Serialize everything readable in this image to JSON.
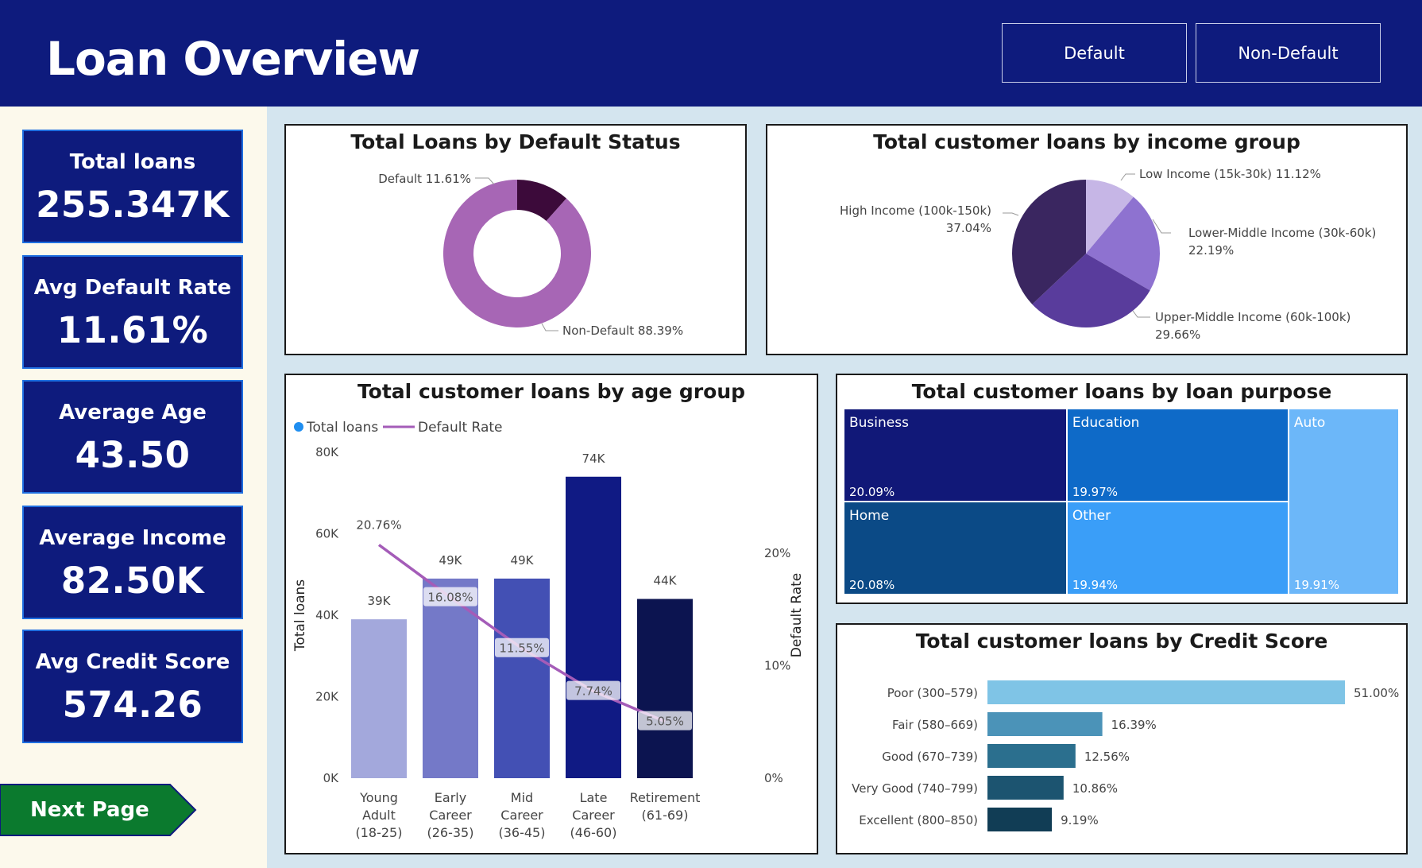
{
  "header": {
    "title": "Loan Overview",
    "buttons": [
      {
        "label": "Default"
      },
      {
        "label": "Non-Default"
      }
    ]
  },
  "kpis": [
    {
      "label": "Total loans",
      "value": "255.347K"
    },
    {
      "label": "Avg Default Rate",
      "value": "11.61%"
    },
    {
      "label": "Average Age",
      "value": "43.50"
    },
    {
      "label": "Average Income",
      "value": "82.50K"
    },
    {
      "label": "Avg Credit Score",
      "value": "574.26"
    }
  ],
  "nav": {
    "next_label": "Next Page"
  },
  "colors": {
    "header": "#0e1b7d",
    "kpi_border": "#1f6fe0",
    "next_button": "#0b7a2e"
  },
  "chart_data": [
    {
      "id": "default-status",
      "type": "pie",
      "variant": "donut",
      "title": "Total Loans by Default Status",
      "slices": [
        {
          "name": "Default",
          "value": 11.61,
          "label": "Default 11.61%",
          "color": "#3c0a3a"
        },
        {
          "name": "Non-Default",
          "value": 88.39,
          "label": "Non-Default 88.39%",
          "color": "#a766b5"
        }
      ]
    },
    {
      "id": "income-group",
      "type": "pie",
      "title": "Total customer loans by income group",
      "slices": [
        {
          "name": "Low Income (15k-30k)",
          "value": 11.12,
          "pct": "11.12%",
          "color": "#c6b6e6"
        },
        {
          "name": "Lower-Middle Income (30k-60k)",
          "value": 22.19,
          "pct": "22.19%",
          "color": "#8e72d0"
        },
        {
          "name": "Upper-Middle Income (60k-100k)",
          "value": 29.66,
          "pct": "29.66%",
          "color": "#593c9c"
        },
        {
          "name": "High Income (100k-150k)",
          "value": 37.04,
          "pct": "37.04%",
          "color": "#3a2660"
        }
      ]
    },
    {
      "id": "age-group",
      "type": "bar",
      "title": "Total customer loans by age group",
      "legend": [
        "Total loans",
        "Default Rate"
      ],
      "ylabel": "Total loans",
      "y2label": "Default Rate",
      "ylim": [
        0,
        80000
      ],
      "y2lim": [
        0,
        29
      ],
      "yticks": [
        "0K",
        "20K",
        "40K",
        "60K",
        "80K"
      ],
      "y2ticks": [
        "0%",
        "10%",
        "20%"
      ],
      "categories": [
        [
          "Young",
          "Adult",
          "(18-25)"
        ],
        [
          "Early",
          "Career",
          "(26-35)"
        ],
        [
          "Mid",
          "Career",
          "(36-45)"
        ],
        [
          "Late",
          "Career",
          "(46-60)"
        ],
        [
          "Retirement",
          "(61-69)"
        ]
      ],
      "series": [
        {
          "name": "Total loans",
          "values": [
            39000,
            49000,
            49000,
            74000,
            44000
          ],
          "labels": [
            "39K",
            "49K",
            "49K",
            "74K",
            "44K"
          ],
          "colors": [
            "#a3a8dc",
            "#7479c8",
            "#4350b4",
            "#101a84",
            "#0c1450"
          ]
        },
        {
          "name": "Default Rate",
          "values": [
            20.76,
            16.08,
            11.55,
            7.74,
            5.05
          ],
          "labels": [
            "20.76%",
            "16.08%",
            "11.55%",
            "7.74%",
            "5.05%"
          ],
          "color": "#a45cb8"
        }
      ]
    },
    {
      "id": "loan-purpose",
      "type": "treemap",
      "title": "Total customer loans by loan purpose",
      "items": [
        {
          "name": "Business",
          "value": 20.09,
          "pct": "20.09%",
          "color": "#111878"
        },
        {
          "name": "Home",
          "value": 20.08,
          "pct": "20.08%",
          "color": "#0b4a86"
        },
        {
          "name": "Education",
          "value": 19.97,
          "pct": "19.97%",
          "color": "#0e6ac8"
        },
        {
          "name": "Other",
          "value": 19.94,
          "pct": "19.94%",
          "color": "#3a9ef8"
        },
        {
          "name": "Auto",
          "value": 19.91,
          "pct": "19.91%",
          "color": "#6cb7f9"
        }
      ]
    },
    {
      "id": "credit-score",
      "type": "bar",
      "orientation": "horizontal",
      "title": "Total customer loans by Credit Score",
      "xlim": [
        0,
        51
      ],
      "categories": [
        "Poor (300–579)",
        "Fair (580–669)",
        "Good (670–739)",
        "Very Good (740–799)",
        "Excellent (800–850)"
      ],
      "values": [
        51.0,
        16.39,
        12.56,
        10.86,
        9.19
      ],
      "labels": [
        "51.00%",
        "16.39%",
        "12.56%",
        "10.86%",
        "9.19%"
      ],
      "colors": [
        "#7fc4e6",
        "#4b93b8",
        "#2b6f8e",
        "#1c5470",
        "#113d55"
      ]
    }
  ]
}
